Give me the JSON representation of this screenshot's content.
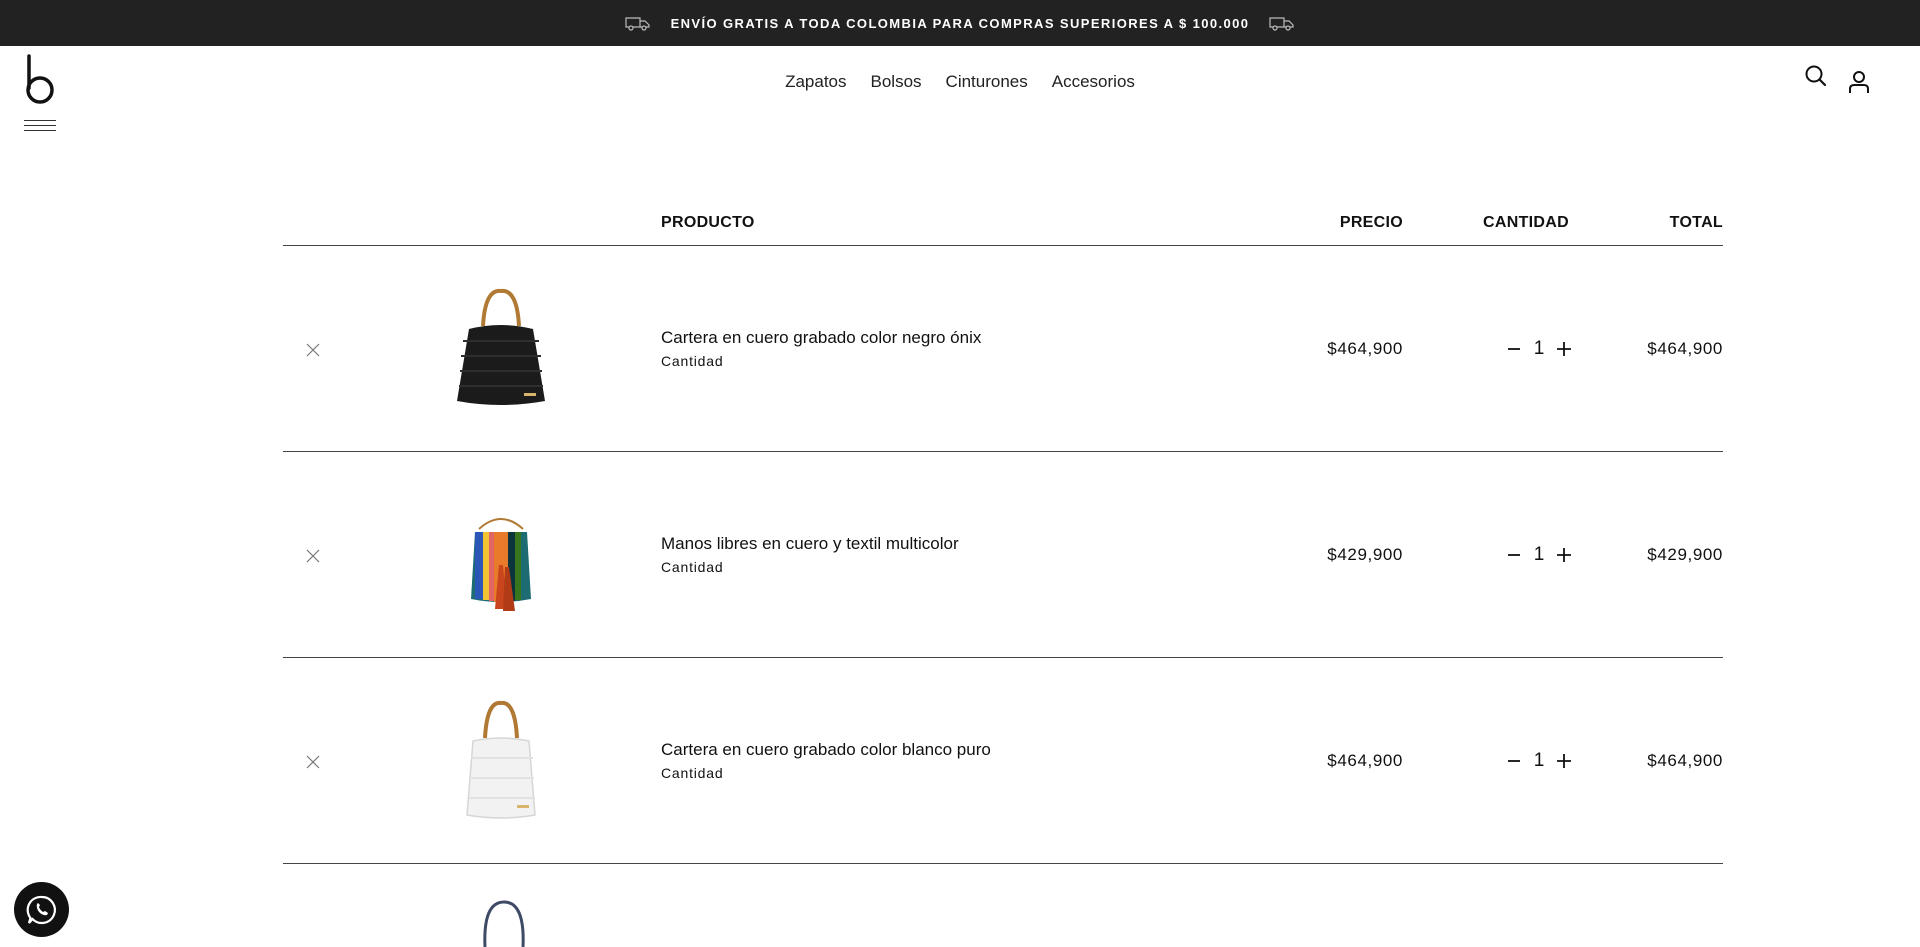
{
  "announcement": {
    "text": "ENVÍO GRATIS A TODA COLOMBIA PARA COMPRAS SUPERIORES A $ 100.000"
  },
  "nav": {
    "items": [
      "Zapatos",
      "Bolsos",
      "Cinturones",
      "Accesorios"
    ]
  },
  "icons": {
    "search": "search-icon",
    "user": "user-icon",
    "menu": "hamburger-icon",
    "whatsapp": "whatsapp-icon",
    "truck": "truck-icon",
    "remove": "close-icon"
  },
  "cart": {
    "headers": {
      "product": "PRODUCTO",
      "price": "PRECIO",
      "quantity": "CANTIDAD",
      "total": "TOTAL"
    },
    "items": [
      {
        "name": "Cartera en cuero grabado color negro ónix",
        "label": "Cantidad",
        "price": "$464,900",
        "qty": "1",
        "total": "$464,900"
      },
      {
        "name": "Manos libres en cuero y textil multicolor",
        "label": "Cantidad",
        "price": "$429,900",
        "qty": "1",
        "total": "$429,900"
      },
      {
        "name": "Cartera en cuero grabado color blanco puro",
        "label": "Cantidad",
        "price": "$464,900",
        "qty": "1",
        "total": "$464,900"
      }
    ]
  },
  "colors": {
    "topbar": "#222222",
    "text": "#111111",
    "divider": "#444444"
  }
}
